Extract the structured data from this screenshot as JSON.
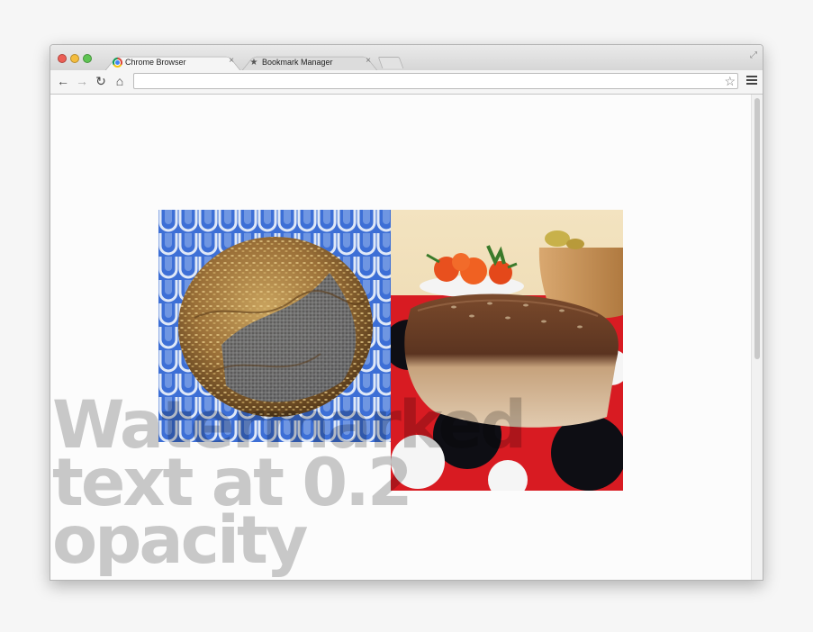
{
  "browser": {
    "tabs": [
      {
        "title": "Chrome Browser",
        "active": true,
        "icon": "chrome-logo-icon"
      },
      {
        "title": "Bookmark Manager",
        "active": false,
        "icon": "star-icon"
      }
    ],
    "close_glyph": "×",
    "omnibox": {
      "value": ""
    }
  },
  "icons": {
    "back": "←",
    "forward": "→",
    "reload": "↻",
    "home": "⌂",
    "star": "☆",
    "fullscreen": "⤢",
    "bookmark_star": "★"
  },
  "page": {
    "watermark": "Watermarked text at 0.2 opacity",
    "images": [
      {
        "subject": "round seeded bread loaf on blue patterned cloth"
      },
      {
        "subject": "bread loaf on red and black tablecloth with tomatoes and bowl"
      }
    ]
  },
  "colors": {
    "watermark": "#000000",
    "traffic_red": "#ec5e55",
    "traffic_yellow": "#f4bd3e",
    "traffic_green": "#5fc453"
  }
}
